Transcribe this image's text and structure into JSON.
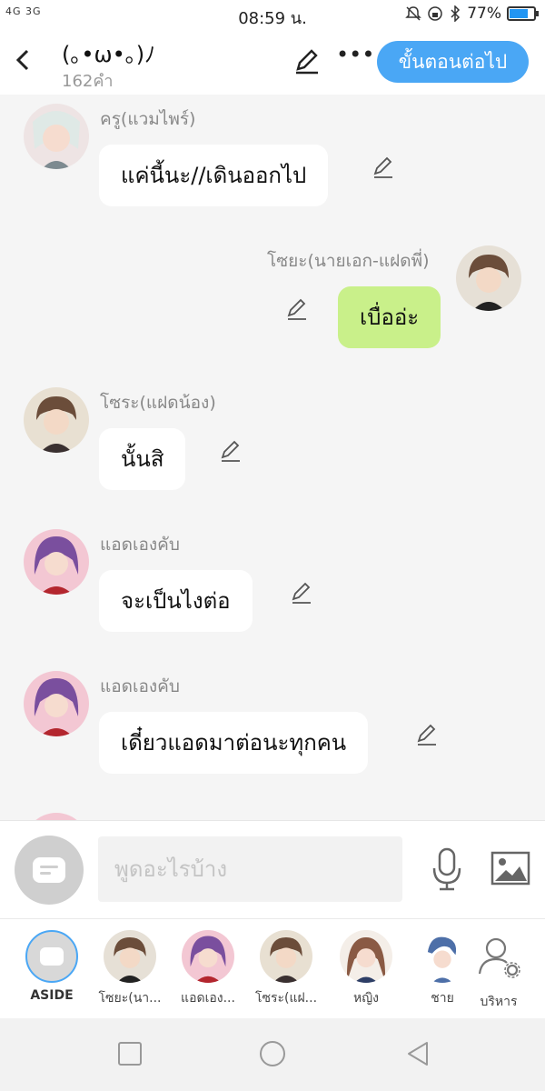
{
  "status_bar": {
    "signal": "4G 3G",
    "time": "08:59 น.",
    "battery": "77%",
    "battery_level": 0.77
  },
  "header": {
    "title": "(｡•ω•｡)ﾉ",
    "word_count": "162คำ",
    "next_button": "ขั้นตอนต่อไป"
  },
  "messages": [
    {
      "sender": "ครู(แวมไพร์)",
      "text": "แค่นี้นะ//เดินออกไป",
      "side": "left"
    },
    {
      "sender": "โซยะ(นายเอก-แฝดพี่)",
      "text": "เบื่ออ่ะ",
      "side": "right"
    },
    {
      "sender": "โซระ(แฝดน้อง)",
      "text": "นั้นสิ",
      "side": "left"
    },
    {
      "sender": "แอดเองคับ",
      "text": "จะเป็นไงต่อ",
      "side": "left"
    },
    {
      "sender": "แอดเองคับ",
      "text": "เดี๋ยวแอดมาต่อนะทุกคน",
      "side": "left"
    }
  ],
  "input": {
    "placeholder": "พูดอะไรบ้าง"
  },
  "characters": [
    {
      "label": "ASIDE"
    },
    {
      "label": "โซยะ(นา..."
    },
    {
      "label": "แอดเอง..."
    },
    {
      "label": "โซระ(แฝ..."
    },
    {
      "label": "หญิง"
    },
    {
      "label": "ชาย"
    },
    {
      "label": "บริหาร"
    }
  ],
  "colors": {
    "accent": "#4aa7f5",
    "my_bubble": "#c9f08a",
    "bubble": "#ffffff",
    "background": "#f5f5f5"
  }
}
